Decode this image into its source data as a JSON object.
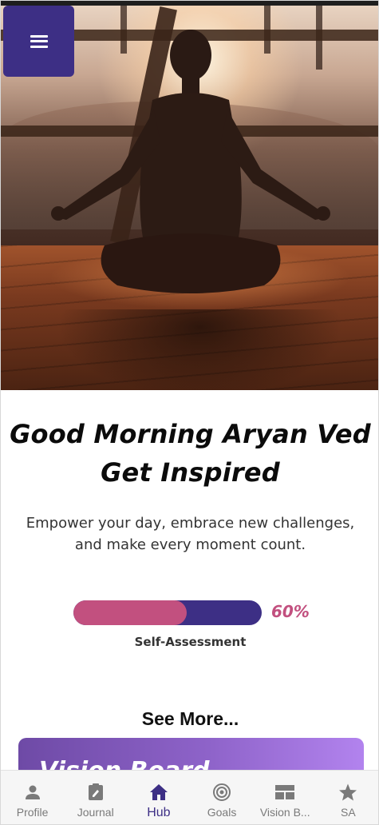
{
  "header": {
    "menu_icon": "hamburger-menu-icon"
  },
  "hero": {
    "image": "woman-meditating-at-sunset"
  },
  "greeting": {
    "line1": "Good Morning Aryan Ved",
    "line2": "Get Inspired"
  },
  "tagline": "Empower your day, embrace new challenges, and make every moment count.",
  "progress": {
    "percent_label": "60%",
    "fraction": 0.6,
    "label": "Self-Assessment",
    "fill_color": "#c2507f",
    "track_color": "#3d2f85"
  },
  "see_more": "See More...",
  "vision_card": {
    "title": "Vision Board"
  },
  "bottom_nav": {
    "items": [
      {
        "label": "Profile",
        "icon": "person-icon"
      },
      {
        "label": "Journal",
        "icon": "journal-icon"
      },
      {
        "label": "Hub",
        "icon": "home-icon",
        "active": true
      },
      {
        "label": "Goals",
        "icon": "target-icon"
      },
      {
        "label": "Vision B...",
        "icon": "vision-board-icon"
      },
      {
        "label": "SA",
        "icon": "star-icon"
      }
    ]
  },
  "colors": {
    "accent": "#3d2f85",
    "pink": "#c2507f",
    "nav_inactive": "#7a7a7a"
  }
}
